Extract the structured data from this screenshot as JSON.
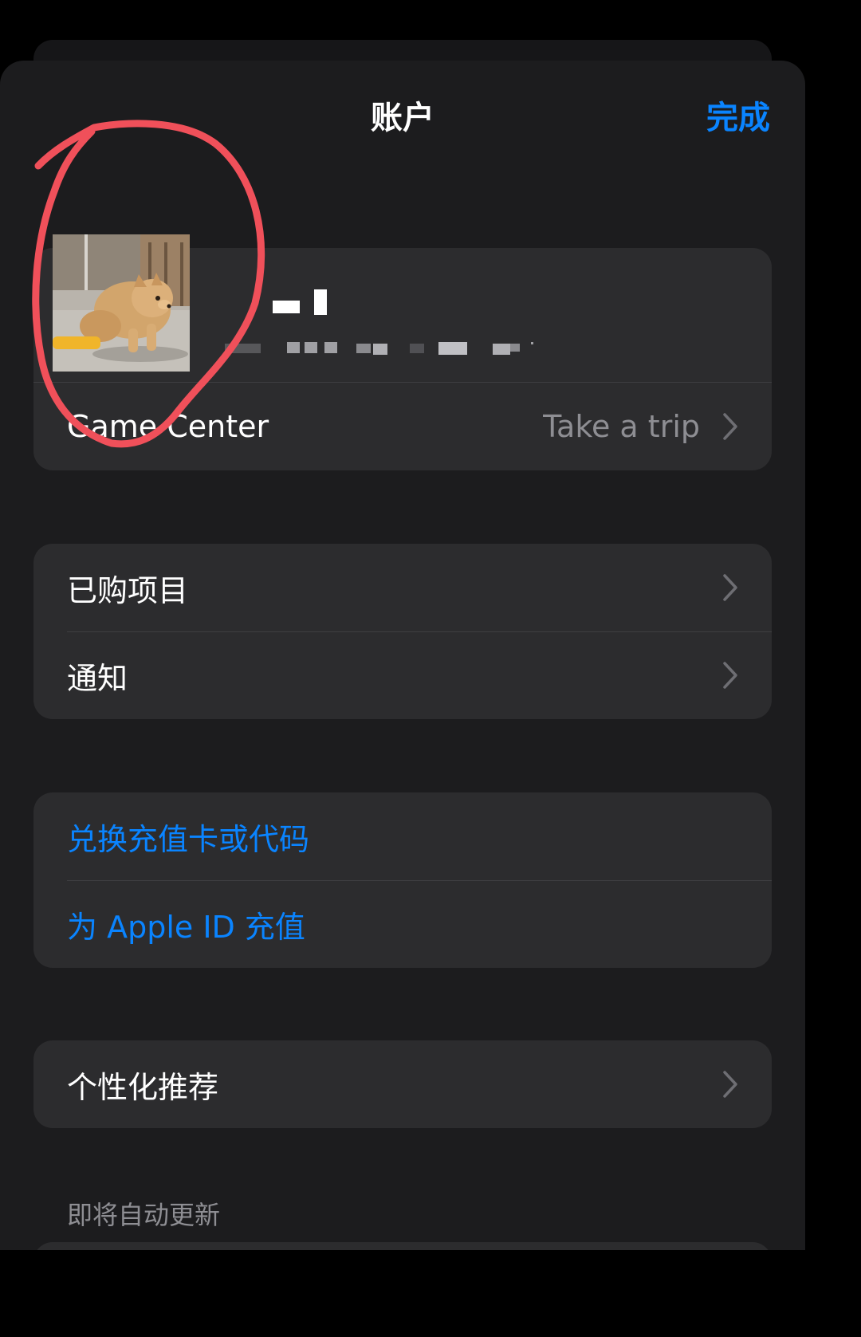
{
  "nav": {
    "title": "账户",
    "done_label": "完成"
  },
  "account": {
    "game_center_label": "Game Center",
    "game_center_value": "Take a trip"
  },
  "group1": {
    "items": [
      {
        "label": "已购项目"
      },
      {
        "label": "通知"
      }
    ]
  },
  "group2": {
    "items": [
      {
        "label": "兑换充值卡或代码"
      },
      {
        "label": "为 Apple ID 充值"
      }
    ]
  },
  "group3": {
    "items": [
      {
        "label": "个性化推荐"
      }
    ]
  },
  "section_header": "即将自动更新",
  "colors": {
    "accent": "#0a84ff",
    "annotation": "#f0505a",
    "background": "#1c1c1e",
    "card": "#2c2c2e"
  },
  "icons": {
    "chevron": "chevron-right-icon",
    "avatar": "dog-photo-avatar"
  }
}
